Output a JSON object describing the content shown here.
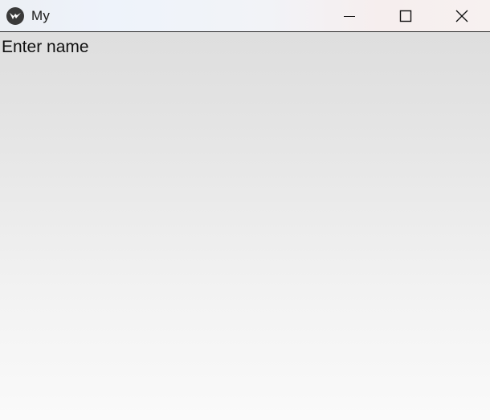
{
  "window": {
    "title": "My",
    "controls": {
      "minimize_icon": "minimize-icon",
      "maximize_icon": "maximize-icon",
      "close_icon": "close-icon"
    },
    "app_icon": "kivy-logo-icon"
  },
  "content": {
    "label_text": "Enter name"
  },
  "colors": {
    "titlebar_border": "#2a2a2a",
    "content_top": "#dedede",
    "content_bottom": "#fafafa",
    "text": "#111111"
  }
}
